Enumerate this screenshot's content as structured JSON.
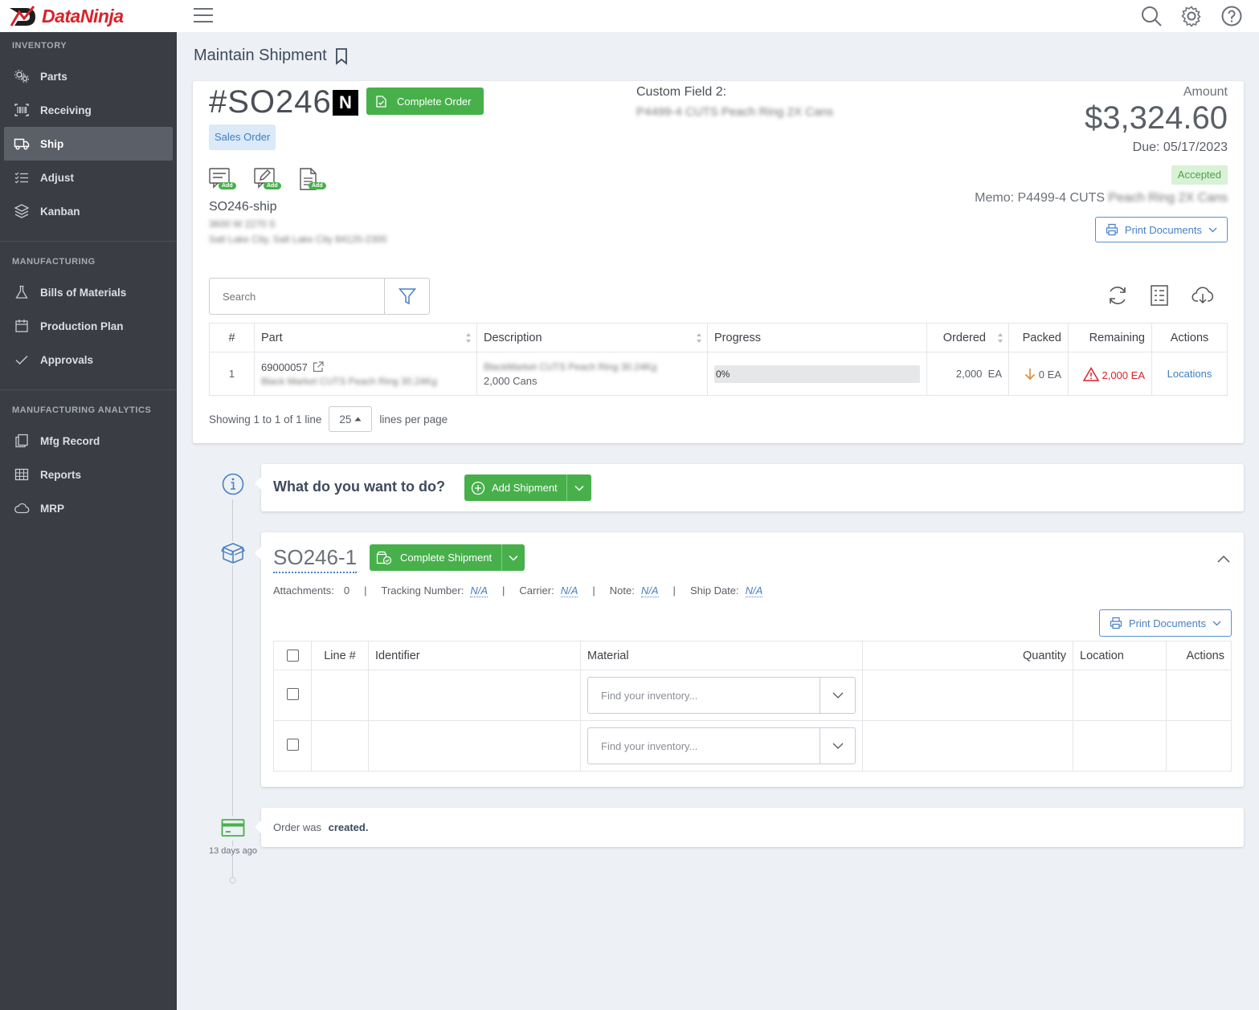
{
  "app": {
    "brand": "DataNinja"
  },
  "colors": {
    "accent_green": "#47b04b",
    "accent_blue": "#4a7fc2",
    "sidebar_bg": "#3a3d44",
    "danger": "#d8232a",
    "warning": "#e28a2d"
  },
  "sidebar": {
    "sections": [
      {
        "title": "INVENTORY",
        "items": [
          {
            "label": "Parts",
            "icon": "gears-icon"
          },
          {
            "label": "Receiving",
            "icon": "barcode-icon"
          },
          {
            "label": "Ship",
            "icon": "truck-icon",
            "active": true
          },
          {
            "label": "Adjust",
            "icon": "list-check-icon"
          },
          {
            "label": "Kanban",
            "icon": "layers-icon"
          }
        ]
      },
      {
        "title": "MANUFACTURING",
        "items": [
          {
            "label": "Bills of Materials",
            "icon": "flask-icon"
          },
          {
            "label": "Production Plan",
            "icon": "calendar-icon"
          },
          {
            "label": "Approvals",
            "icon": "check-icon"
          }
        ]
      },
      {
        "title": "MANUFACTURING ANALYTICS",
        "items": [
          {
            "label": "Mfg Record",
            "icon": "copy-icon"
          },
          {
            "label": "Reports",
            "icon": "grid-icon"
          },
          {
            "label": "MRP",
            "icon": "cloud-icon"
          }
        ]
      }
    ]
  },
  "page": {
    "title": "Maintain Shipment"
  },
  "order": {
    "number": "#SO246",
    "badge": "N",
    "complete_label": "Complete Order",
    "type": "Sales Order",
    "add_tag": "Add",
    "ship_name": "SO246-ship",
    "address_line1": "3600 W 2270 S",
    "address_line2": "Salt Lake City, Salt Lake City 84120-2300",
    "custom_field_label": "Custom Field 2:",
    "custom_field_value": "P4499-4 CUTS Peach Ring 2X Cans",
    "amount_label": "Amount",
    "amount": "$3,324.60",
    "due": "Due: 05/17/2023",
    "status": "Accepted",
    "memo_prefix": "Memo: P4499-4 CUTS",
    "memo_blurred": "Peach Ring 2X Cans",
    "print_label": "Print Documents"
  },
  "search": {
    "placeholder": "Search"
  },
  "lines_table": {
    "headers": [
      "#",
      "Part",
      "Description",
      "Progress",
      "Ordered",
      "Packed",
      "Remaining",
      "Actions"
    ],
    "rows": [
      {
        "num": "1",
        "part": "69000057",
        "part_desc": "Black Market CUTS Peach Ring 30.24Kg",
        "description_blur": "BlackMarket CUTS Peach Ring 30.24Kg",
        "description": "2,000 Cans",
        "progress": "0%",
        "progress_fraction": 0,
        "ordered": "2,000",
        "ordered_unit": "EA",
        "packed": "0",
        "packed_unit": "EA",
        "remaining": "2,000",
        "remaining_unit": "EA",
        "action": "Locations"
      }
    ]
  },
  "pager": {
    "showing": "Showing 1 to 1 of 1 line",
    "per_page": "25",
    "suffix": "lines per page"
  },
  "timeline": {
    "prompt": "What do you want to do?",
    "add_shipment": "Add Shipment",
    "shipment": {
      "id": "SO246-1",
      "complete_label": "Complete Shipment",
      "attachments_label": "Attachments:",
      "attachments": "0",
      "tracking_label": "Tracking Number:",
      "tracking": "N/A",
      "carrier_label": "Carrier:",
      "carrier": "N/A",
      "note_label": "Note:",
      "note": "N/A",
      "ship_date_label": "Ship Date:",
      "ship_date": "N/A",
      "print_label": "Print Documents",
      "headers": [
        "Line #",
        "Identifier",
        "Material",
        "Quantity",
        "Location",
        "Actions"
      ],
      "rows": [
        {
          "material_placeholder": "Find your inventory..."
        },
        {
          "material_placeholder": "Find your inventory..."
        }
      ]
    },
    "event": {
      "text": "Order was",
      "action": "created.",
      "time": "13 days ago"
    }
  }
}
